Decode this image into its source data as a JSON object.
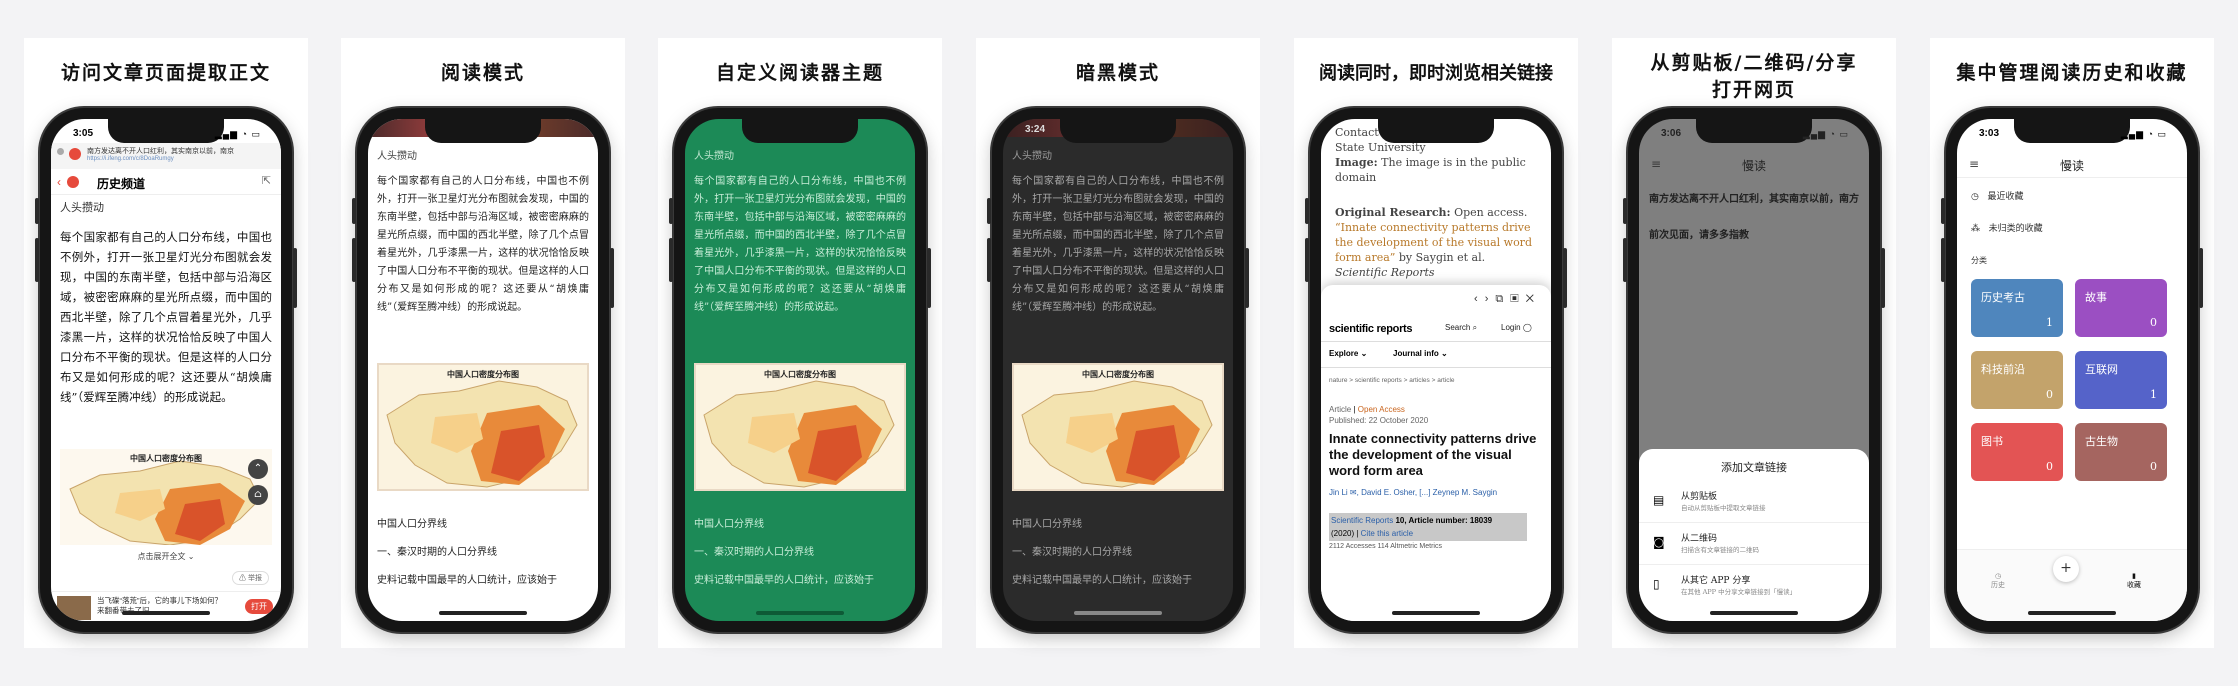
{
  "titles": [
    "访问文章页面提取正文",
    "阅读模式",
    "自定义阅读器主题",
    "暗黑模式",
    "阅读同时，即时浏览相关链接",
    "从剪贴板/二维码/分享",
    "打开网页",
    "集中管理阅读历史和收藏"
  ],
  "p1": {
    "time": "3:05",
    "banner_title": "南方发达离不开人口红利，其实南京以前，南京",
    "banner_url": "https://i.ifeng.com/c/8DoaRumgy",
    "channel": "历史频道",
    "source": "人头攒动",
    "article": "每个国家都有自己的人口分布线，中国也不例外，打开一张卫星灯光分布图就会发现，中国的东南半壁，包括中部与沿海区域，被密密麻麻的星光所点缀，而中国的西北半壁，除了几个点冒着星光外，几乎漆黑一片，这样的状况恰恰反映了中国人口分布不平衡的现状。但是这样的人口分布又是如何形成的呢？这还要从“胡焕庸线”（爱辉至腾冲线）的形成说起。",
    "map_title": "中国人口密度分布图",
    "expand": "点击展开全文",
    "report": "举报",
    "ad_text": "当飞碟“落荒”后，它的事儿下场如何？来翻番带去了旧",
    "ad_button": "打开"
  },
  "reader": {
    "source": "人头攒动",
    "article": "每个国家都有自己的人口分布线，中国也不例外，打开一张卫星灯光分布图就会发现，中国的东南半壁，包括中部与沿海区域，被密密麻麻的星光所点缀，而中国的西北半壁，除了几个点冒着星光外，几乎漆黑一片，这样的状况恰恰反映了中国人口分布不平衡的现状。但是这样的人口分布又是如何形成的呢？这还要从“胡焕庸线”（爱辉至腾冲线）的形成说起。",
    "map_title": "中国人口密度分布图",
    "h1": "中国人口分界线",
    "h2": "一、秦汉时期的人口分界线",
    "p": "史料记载中国最早的人口统计，应该始于",
    "dark_time": "3:24"
  },
  "p5": {
    "top_lines": [
      "Contact",
      "State University"
    ],
    "img_label": "Image:",
    "img_text": " The image is in the public domain",
    "orig_label": "Original Research:",
    "orig_text": " Open access.",
    "orig_link": "“Innate connectivity patterns drive the development of the visual word form area”",
    "orig_by": " by Saygin et al.",
    "orig_journal": "Scientific Reports",
    "sr_logo": "scientific reports",
    "search": "Search",
    "login": "Login",
    "explore": "Explore",
    "journal_info": "Journal info",
    "crumbs": "nature  >  scientific reports  >  articles  >  article",
    "art_type": "Article",
    "open_access": "Open Access",
    "published": "Published: 22 October 2020",
    "headline": "Innate connectivity patterns drive the development of the visual word form area",
    "authors_a": "Jin Li",
    "authors_b": "David E. Osher, [...] Zeynep M. Saygin",
    "cite_a": "Scientific Reports",
    "cite_b": " 10, Article number: 18039",
    "cite_c": "(2020)",
    "cite_d": "Cite this article",
    "metrics": "2112  Accesses    114  Altmetric    Metrics"
  },
  "p6": {
    "time": "3:06",
    "app_title": "慢读",
    "lines": [
      "南方发达离不开人口红利，其实南京以前，南方",
      "前次见面，请多多指教"
    ],
    "sheet_title": "添加文章链接",
    "options": [
      {
        "title": "从剪贴板",
        "sub": "自动从剪贴板中提取文章链接",
        "icon": "clipboard-icon"
      },
      {
        "title": "从二维码",
        "sub": "扫描含有文章链接的二维码",
        "icon": "camera-icon"
      },
      {
        "title": "从其它 APP 分享",
        "sub": "在其他 APP 中分享文章链接到「慢读」",
        "icon": "share-icon"
      }
    ]
  },
  "p7": {
    "time": "3:03",
    "app_title": "慢读",
    "recent": "最近收藏",
    "uncategorized": "未归类的收藏",
    "section": "分类",
    "categories": [
      {
        "name": "历史考古",
        "count": "1",
        "color": "#4f86bd"
      },
      {
        "name": "故事",
        "count": "0",
        "color": "#9b4fc2"
      },
      {
        "name": "科技前沿",
        "count": "0",
        "color": "#c3a36b"
      },
      {
        "name": "互联网",
        "count": "1",
        "color": "#5563c9"
      },
      {
        "name": "图书",
        "count": "0",
        "color": "#e35454"
      },
      {
        "name": "古生物",
        "count": "0",
        "color": "#a56560"
      }
    ],
    "tab_history": "历史",
    "tab_collect": "收藏",
    "fab": "+"
  }
}
